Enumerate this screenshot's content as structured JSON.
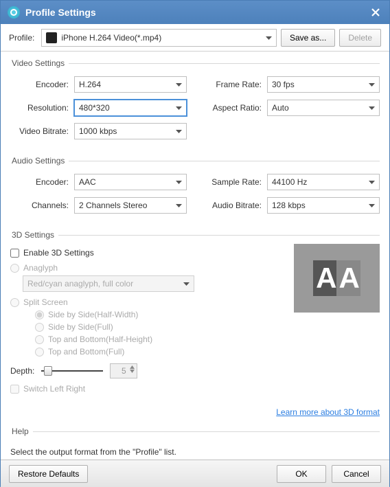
{
  "title": "Profile Settings",
  "profile": {
    "label": "Profile:",
    "value": "iPhone H.264 Video(*.mp4)",
    "save_as": "Save as...",
    "delete": "Delete"
  },
  "video": {
    "legend": "Video Settings",
    "encoder_label": "Encoder:",
    "encoder": "H.264",
    "resolution_label": "Resolution:",
    "resolution": "480*320",
    "bitrate_label": "Video Bitrate:",
    "bitrate": "1000 kbps",
    "framerate_label": "Frame Rate:",
    "framerate": "30 fps",
    "aspect_label": "Aspect Ratio:",
    "aspect": "Auto"
  },
  "audio": {
    "legend": "Audio Settings",
    "encoder_label": "Encoder:",
    "encoder": "AAC",
    "channels_label": "Channels:",
    "channels": "2 Channels Stereo",
    "samplerate_label": "Sample Rate:",
    "samplerate": "44100 Hz",
    "bitrate_label": "Audio Bitrate:",
    "bitrate": "128 kbps"
  },
  "three_d": {
    "legend": "3D Settings",
    "enable": "Enable 3D Settings",
    "anaglyph": "Anaglyph",
    "anaglyph_mode": "Red/cyan anaglyph, full color",
    "split": "Split Screen",
    "sbs_half": "Side by Side(Half-Width)",
    "sbs_full": "Side by Side(Full)",
    "tab_half": "Top and Bottom(Half-Height)",
    "tab_full": "Top and Bottom(Full)",
    "depth_label": "Depth:",
    "depth_value": "5",
    "switch": "Switch Left Right",
    "learn_more": "Learn more about 3D format"
  },
  "help": {
    "legend": "Help",
    "text": "Select the output format from the \"Profile\" list."
  },
  "footer": {
    "restore": "Restore Defaults",
    "ok": "OK",
    "cancel": "Cancel"
  }
}
